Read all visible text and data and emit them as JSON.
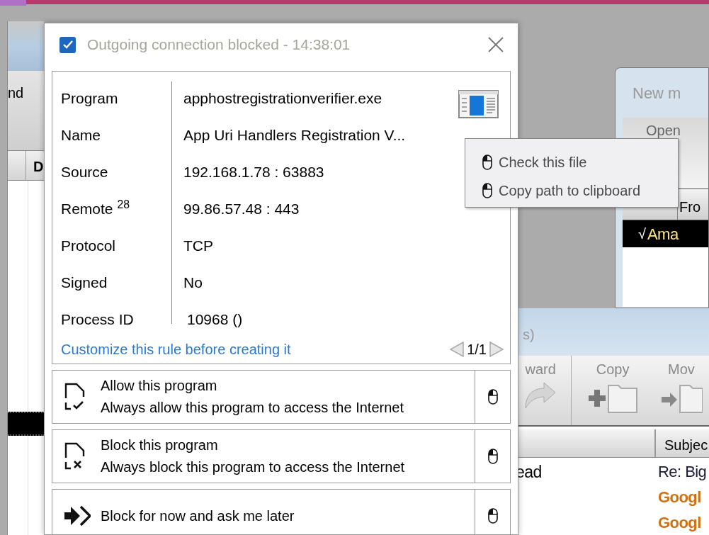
{
  "left_window": {
    "toolbar_label": "nd",
    "column_header": "D"
  },
  "mail_window": {
    "title": "New m",
    "toolbar": [
      "Open"
    ],
    "column_header": "Fro",
    "rows": [
      {
        "check": "√",
        "sender": "Ama",
        "selected": true
      }
    ]
  },
  "list_window": {
    "title": "s)",
    "toolbar": [
      "ward",
      "Copy",
      "Mov"
    ],
    "column_header": "Subjec",
    "rows": [
      {
        "from": "ead",
        "subject": "Re: Big",
        "unread": false
      },
      {
        "subject": "Googl",
        "unread": true
      },
      {
        "subject": "Googl",
        "unread": true
      }
    ]
  },
  "dialog": {
    "checked": true,
    "title": "Outgoing connection blocked - 14:38:01",
    "fields": [
      {
        "label": "Program",
        "value": "apphostregistrationverifier.exe"
      },
      {
        "label": "Name",
        "value": "App Uri Handlers Registration V..."
      },
      {
        "label": "Source",
        "value": "192.168.1.78 : 63883"
      },
      {
        "label": "Remote $^{28}$",
        "value": "99.86.57.48 : 443"
      },
      {
        "label": "Protocol",
        "value": "TCP"
      },
      {
        "label": "Signed",
        "value": "No"
      },
      {
        "label": "Process ID",
        "value": "10968 ()"
      }
    ],
    "link": "Customize this rule before creating it",
    "pager": "1/1",
    "actions": [
      {
        "kind": "allow",
        "title": "Allow this program",
        "description": "Always allow this program to access the Internet"
      },
      {
        "kind": "block",
        "title": "Block this program",
        "description": "Always block this program to access the Internet"
      },
      {
        "kind": "later",
        "title": "Block for now and ask me later"
      }
    ]
  },
  "context_menu": {
    "items": [
      "Check this file",
      "Copy path to clipboard"
    ]
  }
}
